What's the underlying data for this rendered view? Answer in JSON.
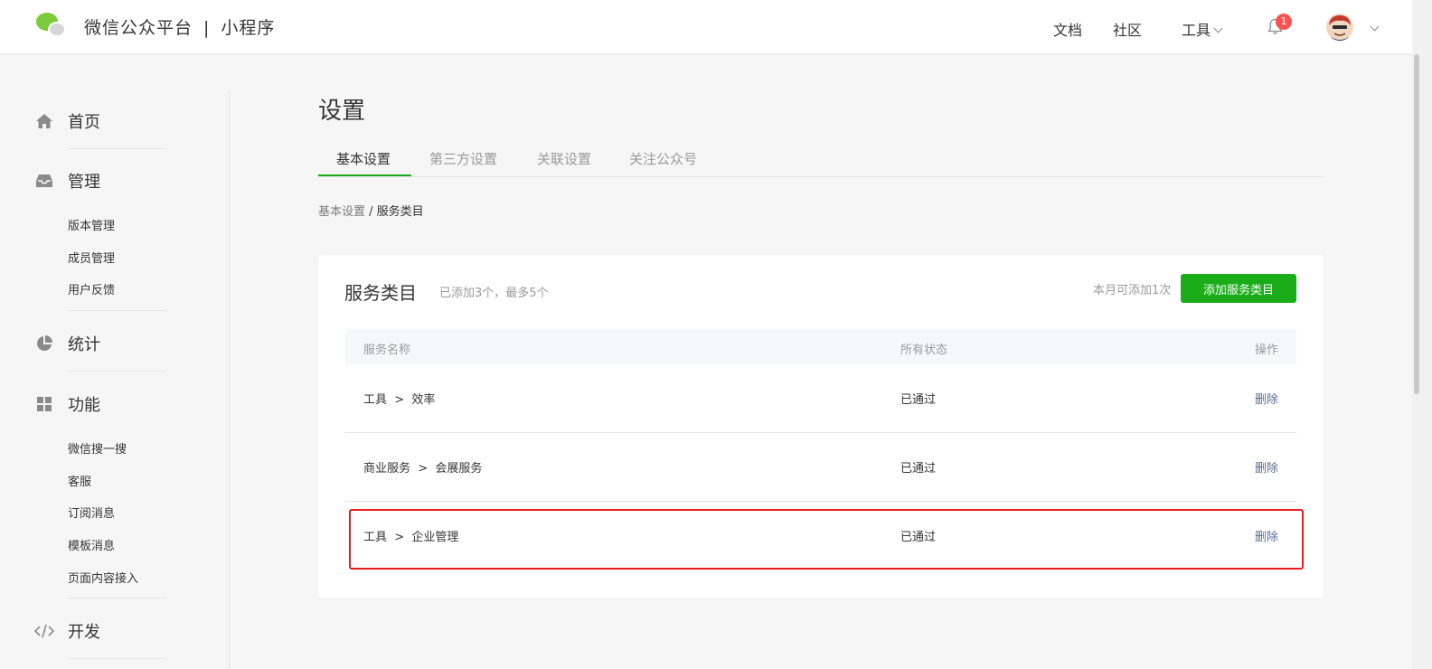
{
  "header": {
    "app_name": "微信公众平台",
    "separator": "|",
    "product": "小程序",
    "nav": {
      "docs": "文档",
      "community": "社区",
      "tools": "工具"
    },
    "notification_count": "1"
  },
  "sidebar": {
    "groups": [
      {
        "label": "首页",
        "icon": "home-icon",
        "items": []
      },
      {
        "label": "管理",
        "icon": "inbox-icon",
        "items": [
          "版本管理",
          "成员管理",
          "用户反馈"
        ]
      },
      {
        "label": "统计",
        "icon": "pie-chart-icon",
        "items": []
      },
      {
        "label": "功能",
        "icon": "grid-icon",
        "items": [
          "微信搜一搜",
          "客服",
          "订阅消息",
          "模板消息",
          "页面内容接入"
        ]
      },
      {
        "label": "开发",
        "icon": "code-icon",
        "items": []
      }
    ]
  },
  "main": {
    "title": "设置",
    "tabs": [
      "基本设置",
      "第三方设置",
      "关联设置",
      "关注公众号"
    ],
    "active_tab": 0,
    "breadcrumb": {
      "parent": "基本设置",
      "sep": " / ",
      "current": "服务类目"
    },
    "card": {
      "title": "服务类目",
      "subtitle": "已添加3个，最多5个",
      "note": "本月可添加1次",
      "add_button": "添加服务类目",
      "columns": {
        "name": "服务名称",
        "status": "所有状态",
        "action": "操作"
      },
      "rows": [
        {
          "name": "工具  >  效率",
          "status": "已通过",
          "action": "删除"
        },
        {
          "name": "商业服务  >  会展服务",
          "status": "已通过",
          "action": "删除"
        },
        {
          "name": "工具  >  企业管理",
          "status": "已通过",
          "action": "删除"
        }
      ]
    }
  },
  "colors": {
    "brand_green": "#1aad19",
    "link_blue": "#576b95",
    "badge_red": "#fa5151",
    "highlight_red": "#e51d1d"
  }
}
